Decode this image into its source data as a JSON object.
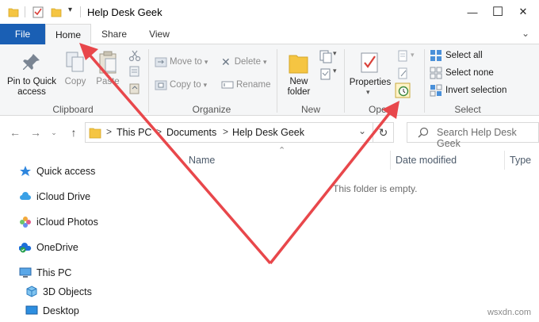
{
  "window": {
    "title": "Help Desk Geek",
    "minimize_glyph": "—",
    "maximize_glyph": "☐",
    "close_glyph": "✕"
  },
  "tabs": [
    {
      "label": "File"
    },
    {
      "label": "Home"
    },
    {
      "label": "Share"
    },
    {
      "label": "View"
    }
  ],
  "ribbon": {
    "clipboard": {
      "label": "Clipboard",
      "pin_label": "Pin to Quick access",
      "copy_label": "Copy",
      "paste_label": "Paste"
    },
    "organize": {
      "label": "Organize",
      "move_to": "Move to",
      "copy_to": "Copy to",
      "delete": "Delete",
      "rename": "Rename"
    },
    "new": {
      "label": "New",
      "new_folder": "New folder"
    },
    "open": {
      "label": "Ope",
      "properties": "Properties"
    },
    "select": {
      "label": "Select",
      "select_all": "Select all",
      "select_none": "Select none",
      "invert_selection": "Invert selection"
    }
  },
  "address": {
    "crumbs": [
      "This PC",
      "Documents",
      "Help Desk Geek"
    ],
    "separator": ">",
    "search_placeholder": "Search Help Desk Geek"
  },
  "nav_pane": [
    {
      "label": "Quick access",
      "icon": "star-icon"
    },
    {
      "label": "iCloud Drive",
      "icon": "cloud-icon"
    },
    {
      "label": "iCloud Photos",
      "icon": "photos-icon"
    },
    {
      "label": "OneDrive",
      "icon": "onedrive-icon"
    },
    {
      "label": "This PC",
      "icon": "pc-icon"
    },
    {
      "label": "3D Objects",
      "icon": "cube-icon"
    },
    {
      "label": "Desktop",
      "icon": "desktop-icon"
    }
  ],
  "columns": [
    "Name",
    "Date modified",
    "Type"
  ],
  "empty_message": "This folder is empty.",
  "watermark": "wsxdn.com",
  "colors": {
    "file_tab": "#1a5fb4",
    "arrow": "#e8474b",
    "folder": "#f5c542"
  }
}
